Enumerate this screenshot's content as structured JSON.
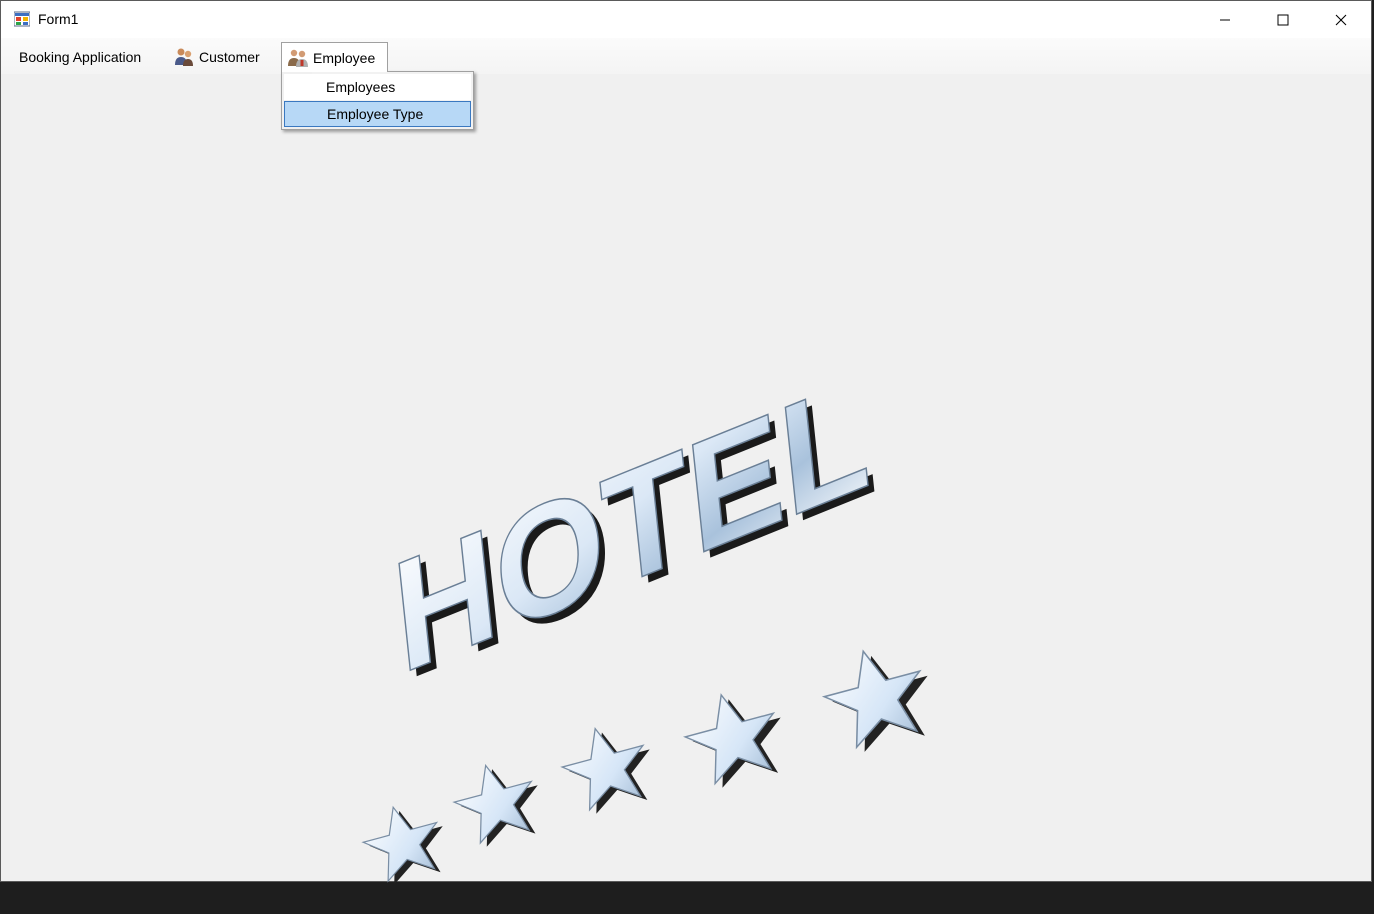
{
  "window": {
    "title": "Form1",
    "minimize_icon": "minimize-icon",
    "maximize_icon": "maximize-icon",
    "close_icon": "close-icon"
  },
  "menubar": {
    "items": [
      {
        "label": "Booking Application"
      },
      {
        "label": "Customer",
        "icon": "customers-icon"
      },
      {
        "label": "Employee",
        "icon": "employees-icon"
      }
    ]
  },
  "dropdown": {
    "items": [
      {
        "label": "Employees"
      },
      {
        "label": "Employee Type",
        "highlighted": true
      }
    ]
  },
  "logo": {
    "text": "HOTEL",
    "stars": 5
  },
  "colors": {
    "titlebar": "#ffffff",
    "background": "#f0f0f0",
    "highlight": "#b7d8f6",
    "highlight_border": "#3a78c0"
  }
}
